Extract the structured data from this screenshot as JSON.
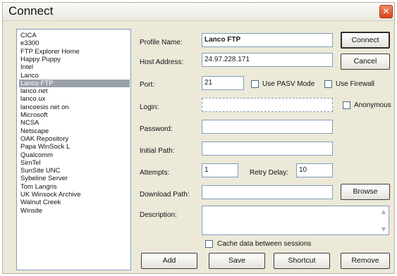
{
  "window": {
    "title": "Connect",
    "close_glyph": "✕"
  },
  "profiles": [
    "CICA",
    "e3300",
    "FTP Explorer Home",
    "Happy Puppy",
    "Intel",
    "Lanco",
    "Lanco FTP",
    "lanco.net",
    "lanco.ux",
    "lancoesis net on",
    "Microsoft",
    "NCSA",
    "Netscape",
    "OAK Repository",
    "Papa WinSock L",
    "Qualcomm",
    "SimTel",
    "SunSite UNC",
    "Sybeline Server",
    "Tom Langris",
    "UK Winsock Archive",
    "Walnut Creek",
    "Winsite"
  ],
  "selected_profile_index": 6,
  "form": {
    "profile_name_label": "Profile Name:",
    "profile_name_value": "Lanco FTP",
    "host_address_label": "Host Address:",
    "host_address_value": "24.97.228.171",
    "port_label": "Port:",
    "port_value": "21",
    "pasv_label": "Use PASV Mode",
    "firewall_label": "Use Firewall",
    "login_label": "Login:",
    "login_value": "",
    "anonymous_label": "Anonymous",
    "password_label": "Password:",
    "password_value": "",
    "initial_path_label": "Initial Path:",
    "initial_path_value": "",
    "attempts_label": "Attempts:",
    "attempts_value": "1",
    "retry_delay_label": "Retry Delay:",
    "retry_delay_value": "10",
    "download_path_label": "Download Path:",
    "download_path_value": "",
    "description_label": "Description:",
    "description_value": "",
    "cache_label": "Cache data between sessions"
  },
  "buttons": {
    "connect": "Connect",
    "cancel": "Cancel",
    "browse": "Browse",
    "add": "Add",
    "save": "Save",
    "shortcut": "Shortcut",
    "remove": "Remove"
  }
}
